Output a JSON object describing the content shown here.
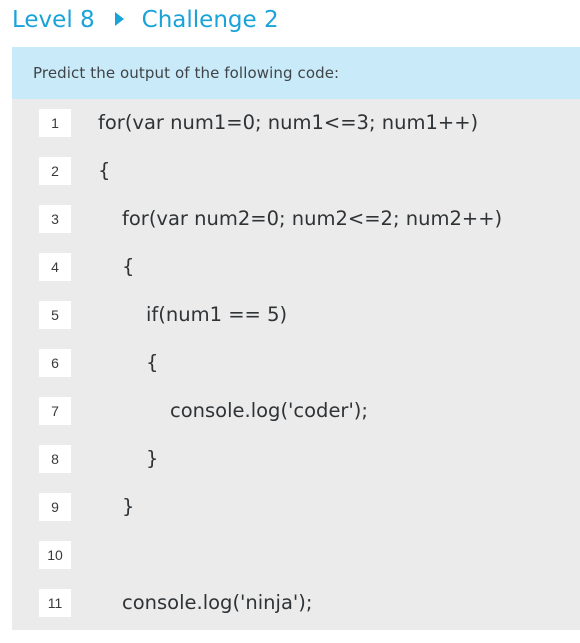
{
  "breadcrumb": {
    "level": "Level 8",
    "separator_icon": "right-triangle-arrow",
    "challenge": "Challenge 2"
  },
  "colors": {
    "accent": "#1aa3d9",
    "prompt_bg": "#c9eaf8",
    "panel_bg": "#ebebeb",
    "line_number_bg": "#ffffff",
    "code_text": "#2f3336"
  },
  "prompt": {
    "text": "Predict the output of the following code:"
  },
  "code": {
    "lines": [
      {
        "number": "1",
        "text": "for(var num1=0; num1<=3; num1++)",
        "indent": 0
      },
      {
        "number": "2",
        "text": "{",
        "indent": 0
      },
      {
        "number": "3",
        "text": "for(var num2=0; num2<=2; num2++)",
        "indent": 1
      },
      {
        "number": "4",
        "text": "{",
        "indent": 1
      },
      {
        "number": "5",
        "text": "if(num1 == 5)",
        "indent": 2
      },
      {
        "number": "6",
        "text": "{",
        "indent": 2
      },
      {
        "number": "7",
        "text": "console.log('coder');",
        "indent": 3
      },
      {
        "number": "8",
        "text": "}",
        "indent": 2
      },
      {
        "number": "9",
        "text": "}",
        "indent": 1
      },
      {
        "number": "10",
        "text": "",
        "indent": 0
      },
      {
        "number": "11",
        "text": "console.log('ninja');",
        "indent": 1
      }
    ]
  }
}
